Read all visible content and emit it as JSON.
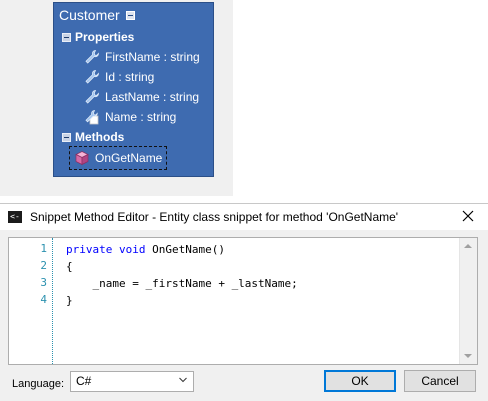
{
  "entity": {
    "title": "Customer",
    "properties_label": "Properties",
    "properties": [
      {
        "text": "FirstName : string",
        "icon": "wrench-icon"
      },
      {
        "text": "Id : string",
        "icon": "wrench-icon"
      },
      {
        "text": "LastName : string",
        "icon": "wrench-icon"
      },
      {
        "text": "Name : string",
        "icon": "wrench-doc-icon"
      }
    ],
    "methods_label": "Methods",
    "methods": [
      {
        "text": "OnGetName",
        "icon": "method-cube-icon"
      }
    ]
  },
  "dialog": {
    "title": "Snippet Method Editor - Entity class snippet for method 'OnGetName'",
    "line_numbers": [
      "1",
      "2",
      "3",
      "4"
    ],
    "code": {
      "line1_kw1": "private",
      "line1_kw2": "void",
      "line1_rest": " OnGetName()",
      "line2": "{",
      "line3": "    _name = _firstName + _lastName;",
      "line4": "}"
    },
    "language_label": "Language:",
    "language_value": "C#",
    "ok_label": "OK",
    "cancel_label": "Cancel"
  },
  "colors": {
    "entity_fill": "#3e6bb0",
    "keyword": "#0000ff",
    "line_number": "#2b91af",
    "focus_border": "#0078d7"
  }
}
